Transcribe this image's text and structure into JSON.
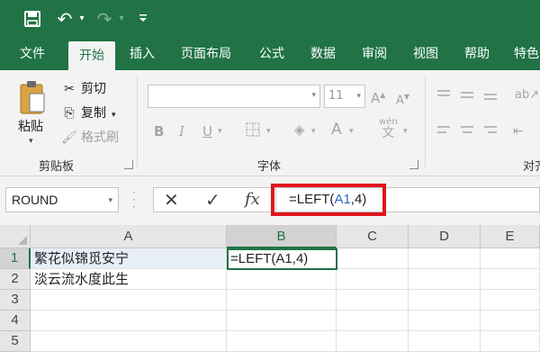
{
  "quick_access": {
    "save_icon": "save-icon",
    "undo_icon": "undo-icon",
    "redo_icon": "redo-icon",
    "customize_icon": "customize-icon"
  },
  "tabs": [
    {
      "label": "文件"
    },
    {
      "label": "开始"
    },
    {
      "label": "插入"
    },
    {
      "label": "页面布局"
    },
    {
      "label": "公式"
    },
    {
      "label": "数据"
    },
    {
      "label": "审阅"
    },
    {
      "label": "视图"
    },
    {
      "label": "帮助"
    },
    {
      "label": "特色"
    }
  ],
  "ribbon": {
    "clipboard": {
      "paste": "粘贴",
      "cut": "剪切",
      "copy": "复制",
      "format_painter": "格式刷",
      "group_label": "剪贴板"
    },
    "font": {
      "font_name": "",
      "font_size": "11",
      "group_label": "字体"
    },
    "alignment": {
      "group_label": "对齐"
    }
  },
  "formula_bar": {
    "name_box": "ROUND",
    "fx": "fx",
    "formula_prefix": "=LEFT(",
    "formula_ref": "A1",
    "formula_suffix": ",4)"
  },
  "grid": {
    "columns": [
      "A",
      "B",
      "C",
      "D",
      "E"
    ],
    "rows": [
      "1",
      "2",
      "3",
      "4",
      "5"
    ],
    "cells": {
      "A1": "繁花似锦觅安宁",
      "A2": "淡云流水度此生",
      "B1": "=LEFT(A1,4)"
    }
  },
  "colors": {
    "brand": "#217346",
    "highlight": "#e0141c",
    "ref": "#2e68c7"
  }
}
